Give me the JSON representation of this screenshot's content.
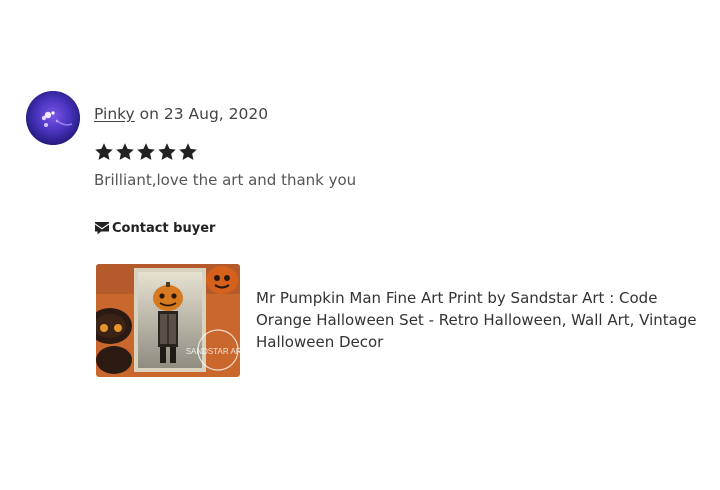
{
  "review": {
    "reviewer_name": "Pinky",
    "date_text": " on 23 Aug, 2020",
    "rating": 5,
    "rating_max": 5,
    "text": "Brilliant,love the art and thank you",
    "contact_label": "Contact buyer"
  },
  "listing": {
    "title": "Mr Pumpkin Man Fine Art Print by Sandstar Art : Code Orange Halloween Set - Retro Halloween, Wall Art, Vintage Halloween Decor",
    "watermark": "SANDSTAR ART"
  },
  "icons": {
    "star": "star-icon",
    "contact": "message-icon"
  },
  "colors": {
    "star": "#222222",
    "text": "#222222",
    "muted": "#555555"
  }
}
